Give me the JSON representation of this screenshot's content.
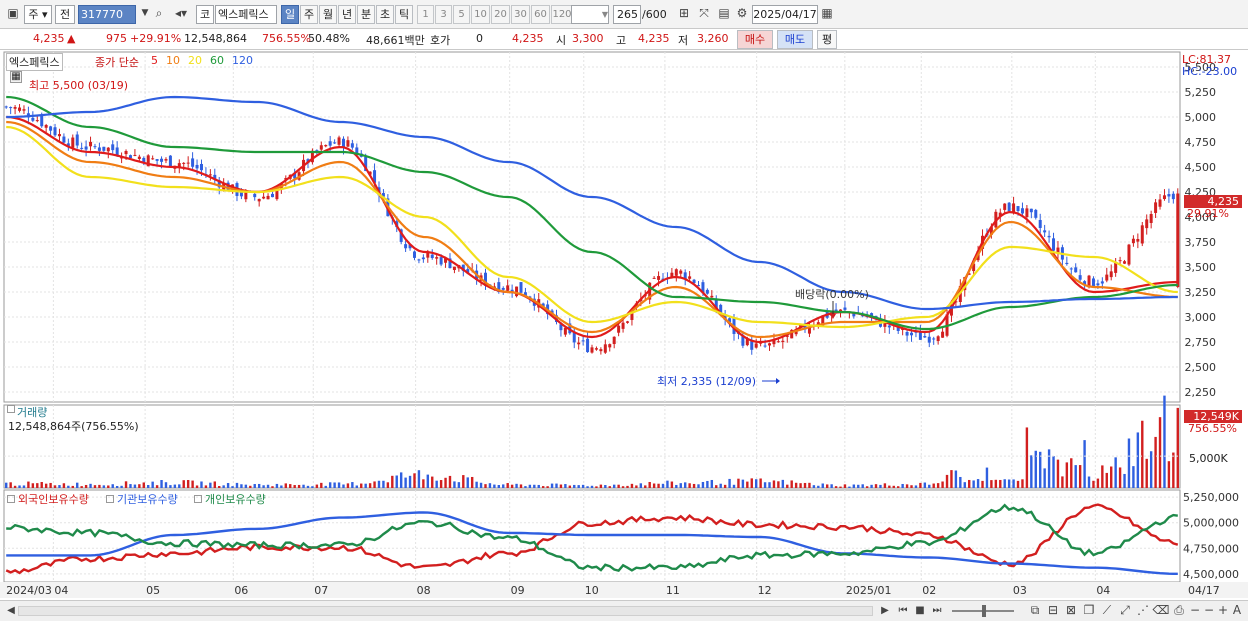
{
  "toolbar": {
    "type_label": "주",
    "prev_label": "전",
    "code": "317770",
    "market_label": "코",
    "stock_name": "엑스페릭스",
    "tabs": [
      "일",
      "주",
      "월",
      "년",
      "분",
      "초",
      "틱"
    ],
    "active_tab": "일",
    "periods": [
      "1",
      "3",
      "5",
      "10",
      "20",
      "30",
      "60",
      "120"
    ],
    "count": "265",
    "count_total": "/600",
    "date": "2025/04/17"
  },
  "quote": {
    "price": "4,235",
    "change": "975",
    "change_pct": "+29.91%",
    "volume": "12,548,864",
    "volume_ratio": "756.55%",
    "turnover": "50.48%",
    "amount": "48,661백만",
    "hoga_label": "호가",
    "hoga_value": "0",
    "hoga_price": "4,235",
    "open_label": "시",
    "open": "3,300",
    "high_label": "고",
    "high": "4,235",
    "low_label": "저",
    "low": "3,260",
    "buy": "매수",
    "sell": "매도",
    "eval": "평"
  },
  "price_panel": {
    "name": "엑스페릭스",
    "ma_label": "종가 단순",
    "ma_periods": [
      "5",
      "10",
      "20",
      "60",
      "120"
    ],
    "ma_colors": [
      "#e01b1b",
      "#f07d14",
      "#f2e01c",
      "#1f9a3a",
      "#2f5fe0"
    ],
    "high_note": "최고 5,500 (03/19)",
    "low_note": "최저 2,335 (12/09)",
    "dividend_note": "배당락(0.00%)",
    "lc": "LC:81.37",
    "hc": "HC:-23.00",
    "last_tag": "4,235",
    "last_pct": "29.91%",
    "ticks": [
      "5,500",
      "5,250",
      "5,000",
      "4,750",
      "4,500",
      "4,250",
      "4,000",
      "3,750",
      "3,500",
      "3,250",
      "3,000",
      "2,750",
      "2,500",
      "2,250"
    ]
  },
  "volume_panel": {
    "title": "거래량",
    "value": "12,548,864주(756.55%)",
    "tag": "12,549K",
    "tag_pct": "756.55%",
    "tick": "5,000K"
  },
  "holding_panel": {
    "legend": [
      "외국인보유수량",
      "기관보유수량",
      "개인보유수량"
    ],
    "ticks": [
      "5,250,000",
      "5,000,000",
      "4,750,000",
      "4,500,000"
    ]
  },
  "x_axis": [
    "2024/03",
    "04",
    "05",
    "06",
    "07",
    "08",
    "09",
    "10",
    "11",
    "12",
    "2025/01",
    "02",
    "03",
    "04",
    "04/17"
  ],
  "chart_data": [
    {
      "type": "candlestick",
      "title": "엑스페릭스",
      "unit": "KRW",
      "x": [
        "2024/03",
        "04",
        "05",
        "06",
        "07",
        "08",
        "09",
        "10",
        "11",
        "12",
        "2025/01",
        "02",
        "03",
        "04",
        "04/17"
      ],
      "close": [
        5100,
        4700,
        4550,
        4200,
        4750,
        3600,
        3300,
        2700,
        3450,
        2700,
        3050,
        2800,
        4100,
        3350,
        4235
      ],
      "ma_series": [
        {
          "name": "5",
          "values": [
            5000,
            4650,
            4500,
            4250,
            4700,
            3650,
            3250,
            2800,
            3400,
            2750,
            3050,
            2850,
            4050,
            3250,
            3350
          ]
        },
        {
          "name": "10",
          "values": [
            4950,
            4550,
            4400,
            4250,
            4550,
            3800,
            3250,
            2850,
            3300,
            2800,
            2950,
            2950,
            3950,
            3300,
            3200
          ]
        },
        {
          "name": "20",
          "values": [
            4900,
            4400,
            4300,
            4250,
            4400,
            4000,
            3400,
            2950,
            3150,
            2950,
            2900,
            3000,
            3700,
            3600,
            3250
          ]
        },
        {
          "name": "60",
          "values": [
            5200,
            4900,
            4700,
            4650,
            4650,
            4450,
            4200,
            3650,
            3200,
            3150,
            3050,
            2880,
            3100,
            3200,
            3320
          ]
        },
        {
          "name": "120",
          "values": [
            5000,
            5050,
            5200,
            5150,
            4950,
            4800,
            4550,
            4200,
            3900,
            3550,
            3250,
            3080,
            3150,
            3180,
            3200
          ]
        }
      ],
      "annotations": [
        "최고 5,500 (03/19)",
        "최저 2,335 (12/09)",
        "배당락(0.00%)"
      ],
      "ylim": [
        2150,
        5650
      ]
    },
    {
      "type": "bar",
      "title": "거래량",
      "x": [
        "2024/03",
        "04",
        "05",
        "06",
        "07",
        "08",
        "09",
        "10",
        "11",
        "12",
        "2025/01",
        "02",
        "03",
        "04",
        "04/17"
      ],
      "values": [
        800,
        700,
        1000,
        600,
        700,
        2500,
        600,
        500,
        900,
        1200,
        500,
        700,
        9000,
        2500,
        12549
      ],
      "unit": "K",
      "ylim": [
        0,
        13000
      ]
    },
    {
      "type": "line",
      "series": [
        {
          "name": "외국인보유수량",
          "values": [
            4520000,
            4650000,
            4700000,
            4760000,
            4760000,
            4560000,
            4700000,
            5000000,
            5050000,
            4980000,
            4960000,
            4880000,
            4600000,
            5150000,
            4800000
          ]
        },
        {
          "name": "기관보유수량",
          "values": [
            4680000,
            4680000,
            4880000,
            4940000,
            5050000,
            5100000,
            4900000,
            4880000,
            4880000,
            4860000,
            4700000,
            4660000,
            4600000,
            4560000,
            4500000
          ]
        },
        {
          "name": "개인보유수량",
          "values": [
            4950000,
            4900000,
            4800000,
            4780000,
            4780000,
            5000000,
            4850000,
            4560000,
            4560000,
            4680000,
            4700000,
            4800000,
            5150000,
            4700000,
            5050000
          ]
        }
      ],
      "x": [
        "2024/03",
        "04",
        "05",
        "06",
        "07",
        "08",
        "09",
        "10",
        "11",
        "12",
        "2025/01",
        "02",
        "03",
        "04",
        "04/17"
      ],
      "ylim": [
        4420000,
        5320000
      ]
    }
  ]
}
